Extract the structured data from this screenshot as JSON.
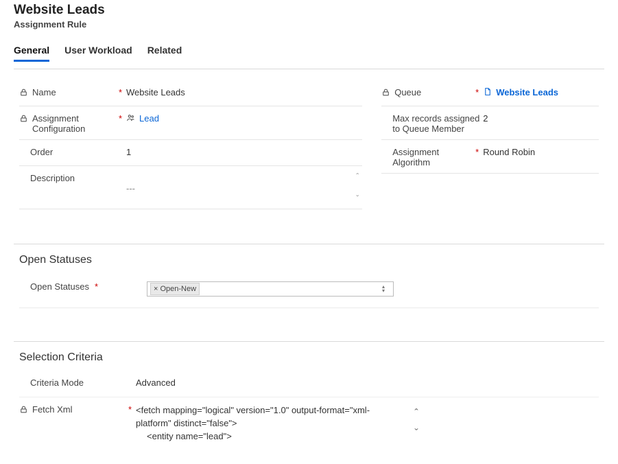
{
  "header": {
    "title": "Website Leads",
    "subtitle": "Assignment Rule"
  },
  "tabs": {
    "general": "General",
    "user_workload": "User Workload",
    "related": "Related"
  },
  "general": {
    "left": {
      "name_label": "Name",
      "name_value": "Website Leads",
      "assign_cfg_label": "Assignment Configuration",
      "assign_cfg_value": "Lead",
      "order_label": "Order",
      "order_value": "1",
      "description_label": "Description",
      "description_value": "---"
    },
    "right": {
      "queue_label": "Queue",
      "queue_value": "Website Leads",
      "max_records_label": "Max records assigned to Queue Member",
      "max_records_value": "2",
      "algo_label": "Assignment Algorithm",
      "algo_value": "Round Robin"
    }
  },
  "open_statuses": {
    "section_title": "Open Statuses",
    "label": "Open Statuses",
    "chip": "× Open-New"
  },
  "selection_criteria": {
    "section_title": "Selection Criteria",
    "mode_label": "Criteria Mode",
    "mode_value": "Advanced",
    "fetch_label": "Fetch Xml",
    "fetch_line1": "<fetch mapping=\"logical\" version=\"1.0\" output-format=\"xml-platform\" distinct=\"false\">",
    "fetch_line2": "<entity name=\"lead\">"
  },
  "icons": {
    "lock": "lock-icon",
    "people": "people-icon",
    "doc": "doc-icon"
  }
}
